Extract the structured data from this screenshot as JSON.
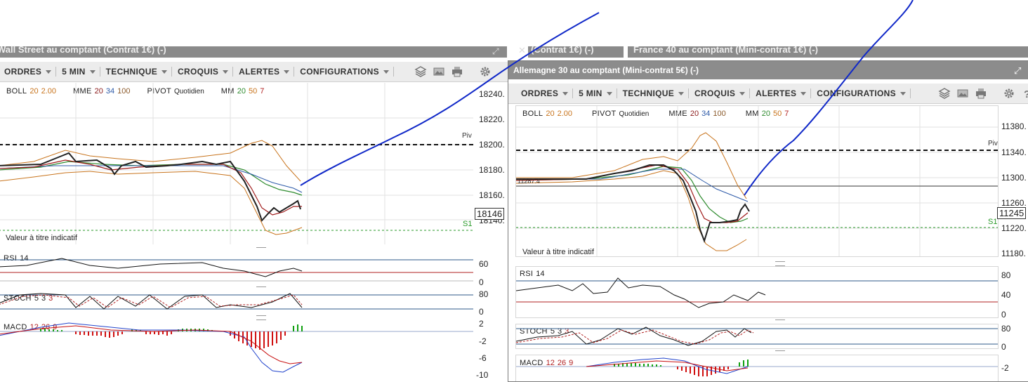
{
  "background_windows": {
    "wallstreet_title": "Wall Street au comptant (Contrat 1€) (-)",
    "third_title_fragment": "(Contrat 1€) (-)",
    "france_title": "France 40 au comptant (Mini-contrat 1€) (-)"
  },
  "left_window": {
    "menu": [
      "ORDRES",
      "5 MIN",
      "TECHNIQUE",
      "CROQUIS",
      "ALERTES",
      "CONFIGURATIONS"
    ],
    "legend": {
      "boll": "BOLL",
      "boll_p1": "20",
      "boll_p2": "2.00",
      "mme": "MME",
      "mme_p1": "20",
      "mme_p2": "34",
      "mme_p3": "100",
      "pivot": "PIVOT",
      "pivot_p": "Quotidien",
      "mm": "MM",
      "mm_p1": "20",
      "mm_p2": "50",
      "mm_p3": "7"
    },
    "price_axis": [
      "18240.",
      "18220.",
      "18200.",
      "18180.",
      "18160.",
      "18140."
    ],
    "current_price": "18146",
    "pivot_label": "Piv",
    "s1_label": "S1",
    "indicative": "Valeur à titre indicatif",
    "rsi": {
      "label": "RSI",
      "param": "14",
      "axis": [
        "60",
        "0"
      ]
    },
    "stoch": {
      "label": "STOCH",
      "p1": "5",
      "p2": "3",
      "p3": "3",
      "axis": [
        "80",
        "0"
      ]
    },
    "macd": {
      "label": "MACD",
      "p1": "12",
      "p2": "26",
      "p3": "9",
      "axis": [
        "2",
        "-2",
        "-6",
        "-10"
      ]
    }
  },
  "right_window": {
    "title": "Allemagne 30 au comptant (Mini-contrat 5€) (-)",
    "menu": [
      "ORDRES",
      "5 MIN",
      "TECHNIQUE",
      "CROQUIS",
      "ALERTES",
      "CONFIGURATIONS"
    ],
    "legend": {
      "boll": "BOLL",
      "boll_p1": "20",
      "boll_p2": "2.00",
      "pivot": "PIVOT",
      "pivot_p": "Quotidien",
      "mme": "MME",
      "mme_p1": "20",
      "mme_p2": "34",
      "mme_p3": "100",
      "mm": "MM",
      "mm_p1": "20",
      "mm_p2": "50",
      "mm_p3": "7"
    },
    "price_axis": [
      "11380.",
      "11340.",
      "11300.",
      "11260.",
      "11220.",
      "11180."
    ],
    "current_price": "11245",
    "small_price": "11287.4",
    "pivot_label": "Piv",
    "s1_label": "S1",
    "indicative": "Valeur à titre indicatif",
    "rsi": {
      "label": "RSI",
      "param": "14",
      "axis": [
        "80",
        "40",
        "0"
      ]
    },
    "stoch": {
      "label": "STOCH",
      "p1": "5",
      "p2": "3",
      "p3": "3",
      "axis": [
        "80",
        "0"
      ]
    },
    "macd": {
      "label": "MACD",
      "p1": "12",
      "p2": "26",
      "p3": "9",
      "axis": [
        "-2"
      ]
    }
  },
  "colors": {
    "boll_param": "#c8741d",
    "mme_p1": "#8b1a1a",
    "mme_p2": "#2d5aa8",
    "mme_p3": "#8b5a2b",
    "mm_p1": "#2e8b2e",
    "mm_p2": "#c8741d",
    "mm_p3": "#b22222",
    "drawing": "#1028c8",
    "macd_neg": "#d01010",
    "macd_pos": "#10a010"
  }
}
